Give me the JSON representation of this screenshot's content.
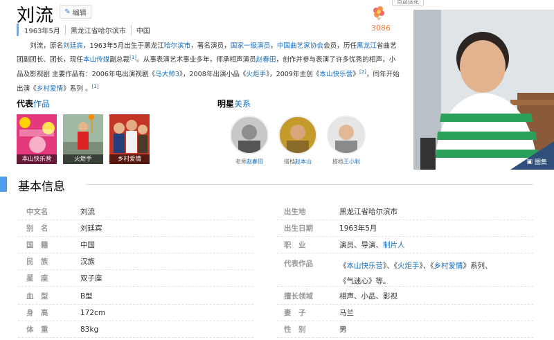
{
  "header": {
    "title": "刘流",
    "edit_label": "编辑",
    "meta": [
      "1963年5月",
      "黑龙江省哈尔滨市",
      "中国"
    ],
    "like_count": "3086",
    "tooltip": "点这送花"
  },
  "summary": {
    "t1": "刘流，原名",
    "l1": "刘廷宾",
    "t2": "，1963年5月出生于黑龙江",
    "l2": "哈尔滨市",
    "t3": "，著名演员，",
    "l3": "国家一级演员",
    "t4": "，",
    "l4": "中国曲艺家协会",
    "t5": "会员，历任",
    "l5": "黑龙江",
    "t6": "省曲艺团副团长、团长，现任",
    "l6": "本山传媒",
    "t7": "副总裁",
    "ref1": "[1]",
    "t8": "。从事表演艺术事业多年，师承相声演员",
    "l7": "赵春田",
    "t9": "，创作并参与表演了许多优秀的相声，小品及影视剧 主要作品有：2006年电出演视剧《",
    "l8": "马大帅3",
    "t10": "》，2008年出演小品《",
    "l9": "火炬手",
    "t11": "》，2009年主创《",
    "l10": "本山快乐营",
    "t12": "》",
    "ref2": "[2]",
    "t13": "，同年开始出演《",
    "l11": "乡村爱情",
    "t14": "》系列 。",
    "ref3": "[1]"
  },
  "works": {
    "title_a": "代表",
    "title_b": "作品",
    "items": [
      {
        "caption": "本山快乐营"
      },
      {
        "caption": "火炬手"
      },
      {
        "caption": "乡村爱情"
      }
    ]
  },
  "stars": {
    "title_a": "明星",
    "title_b": "关系",
    "items": [
      {
        "rel": "老师",
        "name": "赵春田"
      },
      {
        "rel": "搭档",
        "name": "赵本山"
      },
      {
        "rel": "搭档",
        "name": "王小利"
      }
    ]
  },
  "photo": {
    "label": "图集"
  },
  "info": {
    "title": "基本信息",
    "left": [
      {
        "k": "中文名",
        "v": "刘流",
        "link": true
      },
      {
        "k": "别　名",
        "v": "刘廷宾",
        "link": true
      },
      {
        "k": "国　籍",
        "v": "中国",
        "link": false
      },
      {
        "k": "民　族",
        "v": "汉族",
        "link": false
      },
      {
        "k": "星　座",
        "v": "双子座",
        "link": false
      },
      {
        "k": "血　型",
        "v": "B型",
        "link": false
      },
      {
        "k": "身　高",
        "v": "172cm",
        "link": false
      },
      {
        "k": "体　重",
        "v": "83kg",
        "link": false
      }
    ],
    "right": {
      "birthplace_k": "出生地",
      "birthplace_v": "黑龙江省哈尔滨市",
      "birthdate_k": "出生日期",
      "birthdate_v": "1963年5月",
      "job_k": "职　业",
      "job_v": "演员、导演、",
      "job_link": "制片人",
      "works_k": "代表作品",
      "works_a": "《",
      "works_l1": "本山快乐营",
      "works_b": "》、《",
      "works_l2": "火炬手",
      "works_c": "》、《",
      "works_l3": "乡村爱情",
      "works_d": "》系列、",
      "works_e": "《气迷心》等。",
      "field_k": "擅长领域",
      "field_v": "相声、小品、影视",
      "wife_k": "妻　子",
      "wife_v": "马兰",
      "gender_k": "性　别",
      "gender_v": "男"
    }
  },
  "colors": {
    "link": "#136ec2",
    "accent": "#4f9cee",
    "like": "#f07a3c"
  }
}
